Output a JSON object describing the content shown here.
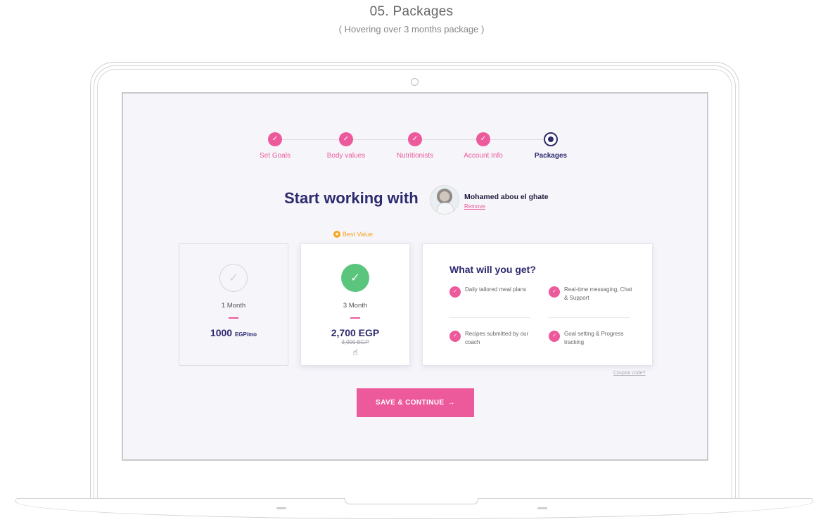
{
  "header": {
    "title": "05. Packages",
    "subtitle": "( Hovering over 3 months package )"
  },
  "stepper": {
    "steps": [
      {
        "label": "Set Goals",
        "state": "done"
      },
      {
        "label": "Body values",
        "state": "done"
      },
      {
        "label": "Nutritionists",
        "state": "done"
      },
      {
        "label": "Account Info",
        "state": "done"
      },
      {
        "label": "Packages",
        "state": "current"
      }
    ],
    "check_icon": "check-icon",
    "done_color": "#ed5a9c",
    "current_color": "#2d2a6e"
  },
  "coach": {
    "heading": "Start working with",
    "name": "Mohamed abou el ghate",
    "remove_label": "Remove"
  },
  "best_value_label": "Best Value",
  "packages": [
    {
      "name": "1 Month",
      "price": "1000",
      "price_unit": "EGP/mo",
      "old_price": "",
      "state": "default"
    },
    {
      "name": "3 Month",
      "price": "2,700 EGP",
      "price_unit": "",
      "old_price": "3,000 EGP",
      "state": "hover"
    }
  ],
  "benefits": {
    "title": "What will you get?",
    "items": [
      "Daily tailored meal plans",
      "Real-time messaging, Chat & Support",
      "Recipes submitted by our coach",
      "Goal setting & Progress tracking"
    ]
  },
  "coupon_label": "Coupon code?",
  "save_button": {
    "label": "SAVE & CONTINUE",
    "arrow": "→"
  },
  "colors": {
    "accent": "#ed5a9c",
    "brand": "#2d2a6e",
    "success": "#5cc57d",
    "warning": "#f5a623",
    "screen_bg": "#f6f5fa"
  }
}
